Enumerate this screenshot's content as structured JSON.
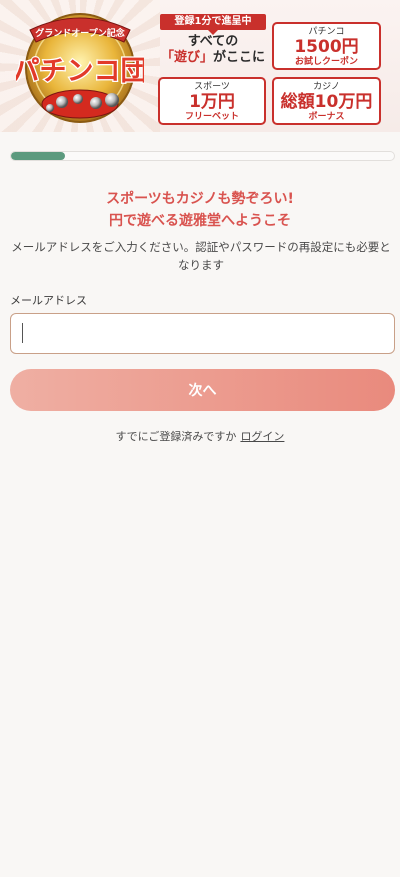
{
  "banner": {
    "ribbon_text": "グランドオープン記念",
    "logo_text": "パチンコ団",
    "promo_badge": "登録1分で進呈中",
    "promo_line1": "すべての",
    "promo_line2_a": "「遊び」",
    "promo_line2_b": "がここに",
    "cards": [
      {
        "caption": "パチンコ",
        "value": "1500円",
        "sub": "お試しクーポン"
      },
      {
        "caption": "スポーツ",
        "value": "1万円",
        "sub": "フリーベット"
      },
      {
        "caption": "カジノ",
        "value": "総額10万円",
        "sub": "ボーナス"
      }
    ]
  },
  "progress": {
    "value": 0.14,
    "color": "#5c9a7e"
  },
  "welcome": {
    "line1": "スポーツもカジノも勢ぞろい!",
    "line2": "円で遊べる遊雅堂へようこそ"
  },
  "description": "メールアドレスをご入力ください。認証やパスワードの再設定にも必要となります",
  "email": {
    "label": "メールアドレス",
    "value": "",
    "placeholder": ""
  },
  "next_button": {
    "label": "次へ"
  },
  "login": {
    "prompt": "すでにご登録済みですか",
    "link": "ログイン"
  },
  "colors": {
    "accent": "#d9534f",
    "brand_red": "#c9302c",
    "background": "#f9f7f5"
  }
}
